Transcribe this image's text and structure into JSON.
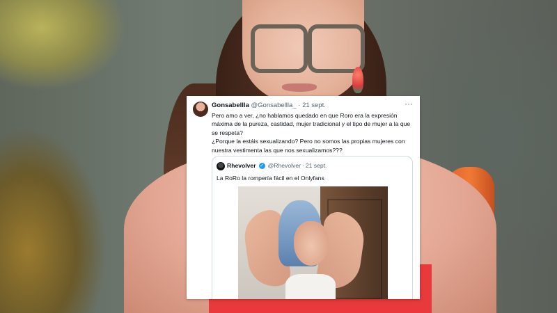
{
  "tweet": {
    "author_name": "Gonsabellla",
    "author_handle": "@Gonsabellla_",
    "separator": "·",
    "date": "21 sept.",
    "more_icon": "more-horizontal-icon",
    "text_line1": "Pero amo a ver, ¿no hablamos quedado en que Roro era la expresión máxima de la pureza, castidad, mujer tradicional y el tipo de mujer a la que se respeta?",
    "text_line2": "¿Porque la estáis sexualizando? Pero no somos las propias mujeres con nuestra vestimenta las que nos sexualizamos???"
  },
  "quoted_tweet": {
    "author_name": "Rhevolver",
    "verified_icon": "verified-badge-icon",
    "author_handle": "@Rhevolver",
    "separator": "·",
    "date": "21 sept.",
    "text": "La RoRo la rompería fácil en el Onlyfans"
  },
  "colors": {
    "card_bg": "#ffffff",
    "text_primary": "#0f1419",
    "text_secondary": "#536471",
    "verified": "#1d9bf0"
  }
}
